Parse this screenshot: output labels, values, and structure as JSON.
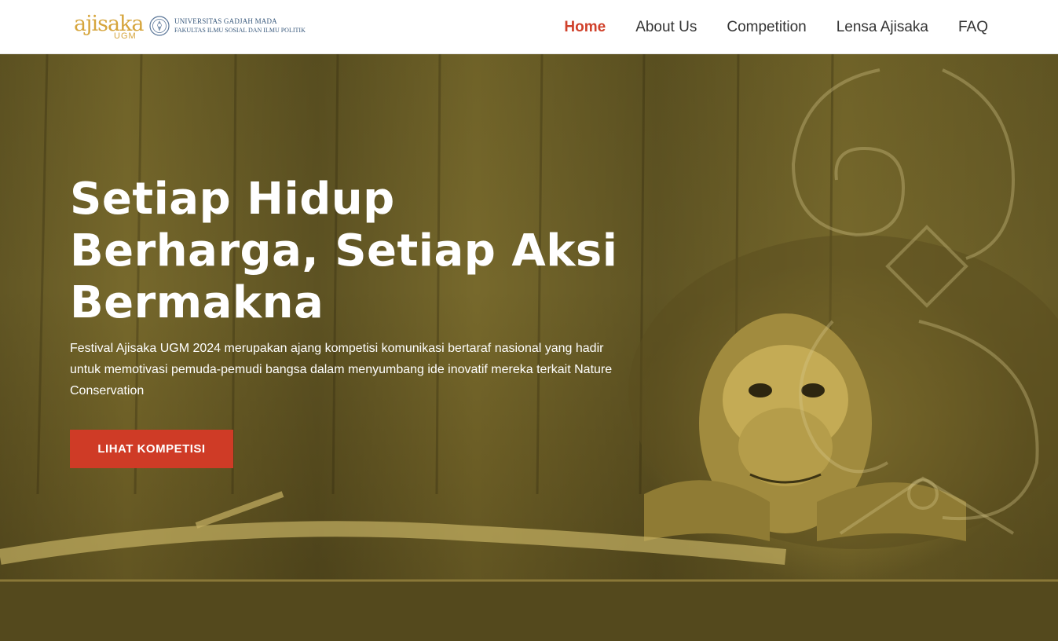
{
  "brand": {
    "logo_text": "ajisaka",
    "logo_sub": "UGM",
    "university": "UNIVERSITAS GADJAH MADA",
    "faculty": "FAKULTAS ILMU SOSIAL DAN ILMU POLITIK"
  },
  "nav": {
    "items": [
      {
        "label": "Home",
        "active": true
      },
      {
        "label": "About Us",
        "active": false
      },
      {
        "label": "Competition",
        "active": false
      },
      {
        "label": "Lensa Ajisaka",
        "active": false
      },
      {
        "label": "FAQ",
        "active": false
      }
    ]
  },
  "hero": {
    "title_lines": [
      "Setiap Hidup",
      "Berharga, Setiap Aksi",
      "Bermakna"
    ],
    "description": "Festival Ajisaka UGM 2024 merupakan ajang kompetisi komunikasi bertaraf nasional yang hadir untuk memotivasi pemuda-pemudi bangsa dalam menyumbang ide inovatif mereka terkait Nature Conservation",
    "cta_label": "LIHAT KOMPETISI",
    "background_icon": "orangutan-photo",
    "ornament_icon": "dayak-ornament-icon"
  },
  "colors": {
    "accent": "#d0402a",
    "button": "#cf3b26",
    "brand_gold": "#d6a53c",
    "brand_blue": "#3a5a7d",
    "hero_tint": "#6f6228"
  }
}
